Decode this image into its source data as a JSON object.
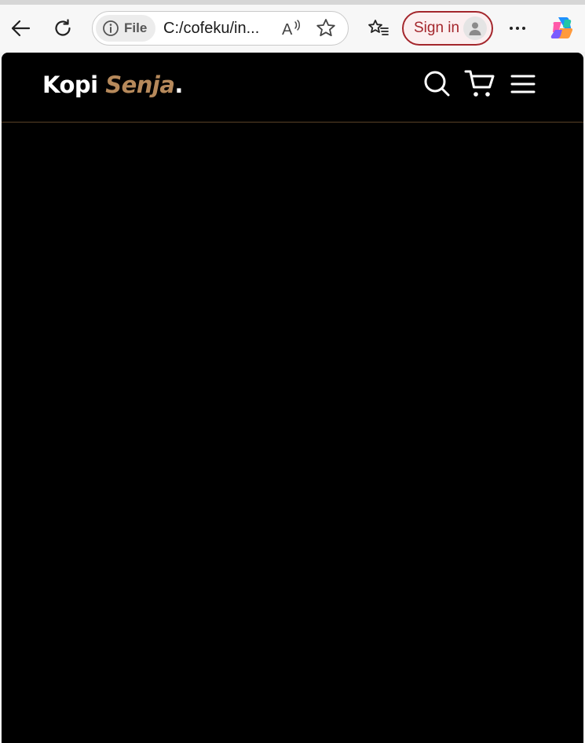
{
  "browser": {
    "address_bar": {
      "site_info_label": "File",
      "url": "C:/cofeku/in..."
    },
    "signin_label": "Sign in",
    "icons": {
      "back": "arrow-left-icon",
      "refresh": "refresh-icon",
      "info": "info-icon",
      "read_aloud": "read-aloud-icon",
      "favorite": "star-icon",
      "favorites": "favorites-list-icon",
      "profile": "person-icon",
      "more": "more-icon",
      "copilot": "copilot-icon"
    },
    "colors": {
      "signin_accent": "#a4262c"
    }
  },
  "site": {
    "logo": {
      "part1": "Kopi ",
      "part2": "Senja",
      "part3": "."
    },
    "nav_icons": [
      "search-icon",
      "cart-icon",
      "menu-icon"
    ],
    "colors": {
      "background": "#000000",
      "accent": "#b6895b",
      "divider": "#5a4127"
    }
  }
}
